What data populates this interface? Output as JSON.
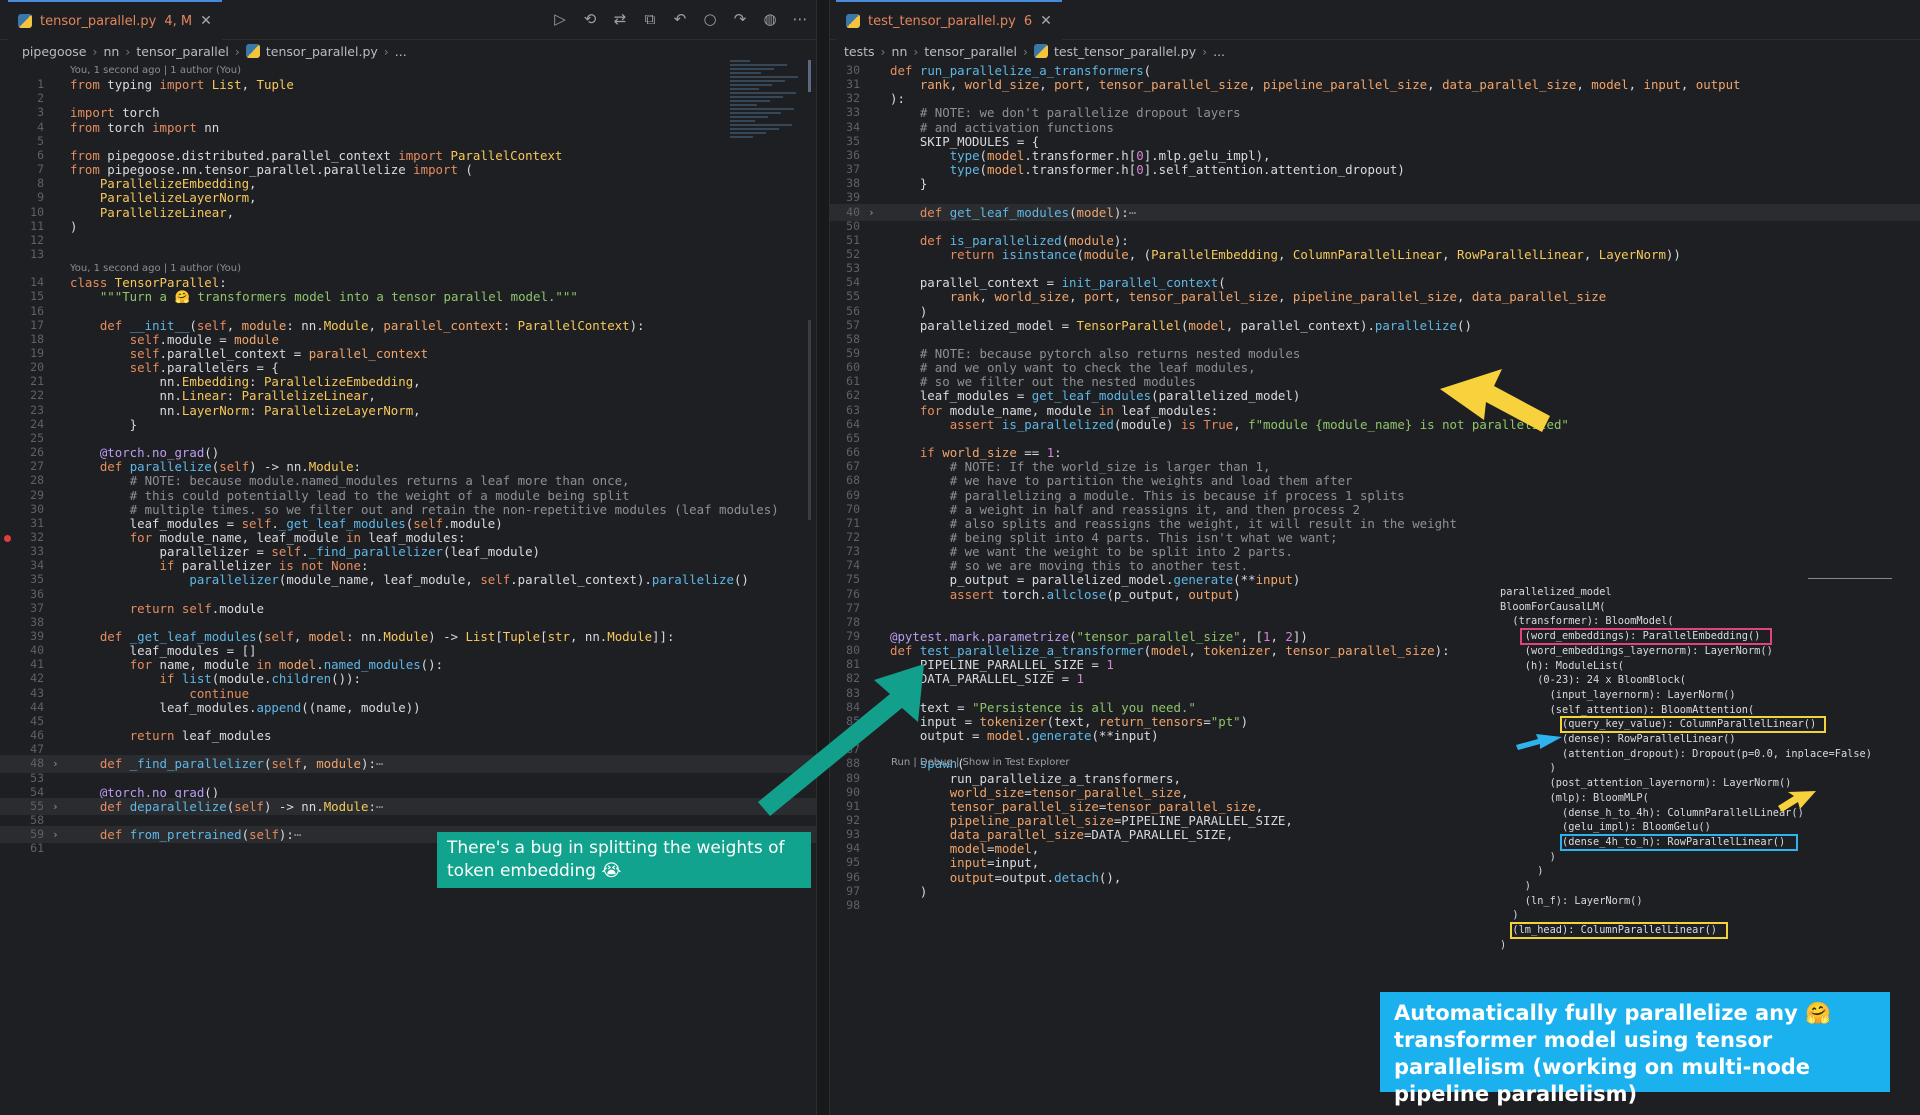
{
  "left": {
    "tab": {
      "name": "tensor_parallel.py",
      "status": "4, M"
    },
    "breadcrumbs": [
      "pipegoose",
      "nn",
      "tensor_parallel",
      "tensor_parallel.py",
      "..."
    ],
    "blame": [
      {
        "line": 1,
        "text": "You, 1 second ago | 1 author (You)"
      },
      {
        "line": 14,
        "text": "You, 1 second ago | 1 author (You)"
      }
    ],
    "lines": [
      {
        "n": "1",
        "h": "<span class='kw'>from</span> typing <span class='kw'>import</span> <span class='cl'>List</span>, <span class='cl'>Tuple</span>"
      },
      {
        "n": "2",
        "h": ""
      },
      {
        "n": "3",
        "h": "<span class='kw'>import</span> torch"
      },
      {
        "n": "4",
        "h": "<span class='kw'>from</span> torch <span class='kw'>import</span> nn"
      },
      {
        "n": "5",
        "h": ""
      },
      {
        "n": "6",
        "h": "<span class='kw'>from</span> pipegoose.distributed.parallel_context <span class='kw'>import</span> <span class='cl'>ParallelContext</span>"
      },
      {
        "n": "7",
        "h": "<span class='kw'>from</span> pipegoose.nn.tensor_parallel.parallelize <span class='kw'>import</span> ("
      },
      {
        "n": "8",
        "h": "    <span class='cl'>ParallelizeEmbedding</span>,"
      },
      {
        "n": "9",
        "h": "    <span class='cl'>ParallelizeLayerNorm</span>,"
      },
      {
        "n": "10",
        "h": "    <span class='cl'>ParallelizeLinear</span>,"
      },
      {
        "n": "11",
        "h": ")"
      },
      {
        "n": "12",
        "h": ""
      },
      {
        "n": "13",
        "h": ""
      },
      {
        "n": "14",
        "h": "<span class='kw'>class</span> <span class='cl'>TensorParallel</span>:"
      },
      {
        "n": "15",
        "h": "    <span class='st'>\"\"\"Turn a 🤗 transformers model into a tensor parallel model.\"\"\"</span>"
      },
      {
        "n": "16",
        "h": ""
      },
      {
        "n": "17",
        "h": "    <span class='kw'>def</span> <span class='fn'>__init__</span>(<span class='self'>self</span>, <span class='pa'>module</span>: nn.<span class='cl'>Module</span>, <span class='pa'>parallel_context</span>: <span class='cl'>ParallelContext</span>):"
      },
      {
        "n": "18",
        "h": "        <span class='self'>self</span>.module = <span class='pa'>module</span>"
      },
      {
        "n": "19",
        "h": "        <span class='self'>self</span>.parallel_context = <span class='pa'>parallel_context</span>"
      },
      {
        "n": "20",
        "h": "        <span class='self'>self</span>.parallelers = {"
      },
      {
        "n": "21",
        "h": "            nn.<span class='cl'>Embedding</span>: <span class='cl'>ParallelizeEmbedding</span>,"
      },
      {
        "n": "22",
        "h": "            nn.<span class='cl'>Linear</span>: <span class='cl'>ParallelizeLinear</span>,"
      },
      {
        "n": "23",
        "h": "            nn.<span class='cl'>LayerNorm</span>: <span class='cl'>ParallelizeLayerNorm</span>,"
      },
      {
        "n": "24",
        "h": "        }"
      },
      {
        "n": "25",
        "h": ""
      },
      {
        "n": "26",
        "h": "    <span class='dc'>@torch.no_grad</span>()"
      },
      {
        "n": "27",
        "h": "    <span class='kw'>def</span> <span class='fn'>parallelize</span>(<span class='self'>self</span>) -> nn.<span class='cl'>Module</span>:"
      },
      {
        "n": "28",
        "h": "        <span class='cm'># NOTE: because module.named_modules returns a leaf more than once,</span>"
      },
      {
        "n": "29",
        "h": "        <span class='cm'># this could potentially lead to the weight of a module being split</span>"
      },
      {
        "n": "30",
        "h": "        <span class='cm'># multiple times. so we filter out and retain the non-repetitive modules (leaf modules)</span>"
      },
      {
        "n": "31",
        "h": "        leaf_modules = <span class='self'>self</span>.<span class='fn'>_get_leaf_modules</span>(<span class='self'>self</span>.module)"
      },
      {
        "n": "32",
        "h": "        <span class='kw'>for</span> module_name, leaf_module <span class='kw'>in</span> leaf_modules:",
        "dot": true
      },
      {
        "n": "33",
        "h": "            parallelizer = <span class='self'>self</span>.<span class='fn'>_find_parallelizer</span>(leaf_module)"
      },
      {
        "n": "34",
        "h": "            <span class='kw'>if</span> parallelizer <span class='kw'>is not</span> <span class='kw'>None</span>:"
      },
      {
        "n": "35",
        "h": "                <span class='fn'>parallelizer</span>(module_name, leaf_module, <span class='self'>self</span>.parallel_context).<span class='fn'>parallelize</span>()"
      },
      {
        "n": "36",
        "h": ""
      },
      {
        "n": "37",
        "h": "        <span class='kw'>return</span> <span class='self'>self</span>.module"
      },
      {
        "n": "38",
        "h": ""
      },
      {
        "n": "39",
        "h": "    <span class='kw'>def</span> <span class='fn'>_get_leaf_modules</span>(<span class='self'>self</span>, <span class='pa'>model</span>: nn.<span class='cl'>Module</span>) -> <span class='cl'>List</span>[<span class='cl'>Tuple</span>[<span class='cl'>str</span>, nn.<span class='cl'>Module</span>]]:"
      },
      {
        "n": "40",
        "h": "        leaf_modules = []"
      },
      {
        "n": "41",
        "h": "        <span class='kw'>for</span> name, module <span class='kw'>in</span> <span class='pa'>model</span>.<span class='fn'>named_modules</span>():"
      },
      {
        "n": "42",
        "h": "            <span class='kw'>if</span> <span class='fn'>list</span>(module.<span class='fn'>children</span>()):"
      },
      {
        "n": "43",
        "h": "                <span class='kw'>continue</span>"
      },
      {
        "n": "44",
        "h": "            leaf_modules.<span class='fn'>append</span>((name, module))"
      },
      {
        "n": "45",
        "h": ""
      },
      {
        "n": "46",
        "h": "        <span class='kw'>return</span> leaf_modules"
      },
      {
        "n": "47",
        "h": ""
      },
      {
        "n": "48",
        "h": "    <span class='kw'>def</span> <span class='fn'>_find_parallelizer</span>(<span class='self'>self</span>, <span class='pa'>module</span>):<span class='cm'>⋯</span>",
        "fold": true,
        "hl": true
      },
      {
        "n": "53",
        "h": ""
      },
      {
        "n": "54",
        "h": "    <span class='dc'>@torch.no_grad</span>()"
      },
      {
        "n": "55",
        "h": "    <span class='kw'>def</span> <span class='fn'>deparallelize</span>(<span class='self'>self</span>) -> nn.<span class='cl'>Module</span>:<span class='cm'>⋯</span>",
        "fold": true,
        "hl": true
      },
      {
        "n": "58",
        "h": ""
      },
      {
        "n": "59",
        "h": "    <span class='kw'>def</span> <span class='fn'>from_pretrained</span>(<span class='self'>self</span>):<span class='cm'>⋯</span>",
        "fold": true,
        "hl": true
      },
      {
        "n": "61",
        "h": ""
      }
    ]
  },
  "right": {
    "tab": {
      "name": "test_tensor_parallel.py",
      "status": "6"
    },
    "breadcrumbs": [
      "tests",
      "nn",
      "tensor_parallel",
      "test_tensor_parallel.py",
      "..."
    ],
    "codelens": "Run | Debug | Show in Test Explorer",
    "lines": [
      {
        "n": "30",
        "h": "<span class='kw'>def</span> <span class='fn'>run_parallelize_a_transformers</span>("
      },
      {
        "n": "31",
        "h": "    <span class='pa'>rank</span>, <span class='pa'>world_size</span>, <span class='pa'>port</span>, <span class='pa'>tensor_parallel_size</span>, <span class='pa'>pipeline_parallel_size</span>, <span class='pa'>data_parallel_size</span>, <span class='pa'>model</span>, <span class='pa'>input</span>, <span class='pa'>output</span>"
      },
      {
        "n": "32",
        "h": "):"
      },
      {
        "n": "33",
        "h": "    <span class='cm'># NOTE: we don't parallelize dropout layers</span>"
      },
      {
        "n": "34",
        "h": "    <span class='cm'># and activation functions</span>"
      },
      {
        "n": "35",
        "h": "    SKIP_MODULES = {"
      },
      {
        "n": "36",
        "h": "        <span class='fn'>type</span>(<span class='pa'>model</span>.transformer.h[<span class='nm'>0</span>].mlp.gelu_impl),"
      },
      {
        "n": "37",
        "h": "        <span class='fn'>type</span>(<span class='pa'>model</span>.transformer.h[<span class='nm'>0</span>].self_attention.attention_dropout)"
      },
      {
        "n": "38",
        "h": "    }"
      },
      {
        "n": "39",
        "h": ""
      },
      {
        "n": "40",
        "h": "    <span class='kw'>def</span> <span class='fn'>get_leaf_modules</span>(<span class='pa'>model</span>):<span class='cm'>⋯</span>",
        "fold": true,
        "hl": true
      },
      {
        "n": "50",
        "h": ""
      },
      {
        "n": "51",
        "h": "    <span class='kw'>def</span> <span class='fn'>is_parallelized</span>(<span class='pa'>module</span>):"
      },
      {
        "n": "52",
        "h": "        <span class='kw'>return</span> <span class='fn'>isinstance</span>(<span class='pa'>module</span>, (<span class='cl'>ParallelEmbedding</span>, <span class='cl'>ColumnParallelLinear</span>, <span class='cl'>RowParallelLinear</span>, <span class='cl'>LayerNorm</span>))"
      },
      {
        "n": "53",
        "h": ""
      },
      {
        "n": "54",
        "h": "    parallel_context = <span class='fn'>init_parallel_context</span>("
      },
      {
        "n": "55",
        "h": "        <span class='pa'>rank</span>, <span class='pa'>world_size</span>, <span class='pa'>port</span>, <span class='pa'>tensor_parallel_size</span>, <span class='pa'>pipeline_parallel_size</span>, <span class='pa'>data_parallel_size</span>"
      },
      {
        "n": "56",
        "h": "    )"
      },
      {
        "n": "57",
        "h": "    parallelized_model = <span class='cl'>TensorParallel</span>(<span class='pa'>model</span>, parallel_context).<span class='fn'>parallelize</span>()"
      },
      {
        "n": "58",
        "h": ""
      },
      {
        "n": "59",
        "h": "    <span class='cm'># NOTE: because pytorch also returns nested modules</span>"
      },
      {
        "n": "60",
        "h": "    <span class='cm'># and we only want to check the leaf modules,</span>"
      },
      {
        "n": "61",
        "h": "    <span class='cm'># so we filter out the nested modules</span>"
      },
      {
        "n": "62",
        "h": "    leaf_modules = <span class='fn'>get_leaf_modules</span>(parallelized_model)"
      },
      {
        "n": "63",
        "h": "    <span class='kw'>for</span> module_name, module <span class='kw'>in</span> leaf_modules:"
      },
      {
        "n": "64",
        "h": "        <span class='kw'>assert</span> <span class='fn'>is_parallelized</span>(module) <span class='kw'>is</span> <span class='kw'>True</span>, <span class='st'>f\"module {module_name} is not parallelized\"</span>"
      },
      {
        "n": "65",
        "h": ""
      },
      {
        "n": "66",
        "h": "    <span class='kw'>if</span> <span class='pa'>world_size</span> == <span class='nm'>1</span>:"
      },
      {
        "n": "67",
        "h": "        <span class='cm'># NOTE: If the world_size is larger than 1,</span>"
      },
      {
        "n": "68",
        "h": "        <span class='cm'># we have to partition the weights and load them after</span>"
      },
      {
        "n": "69",
        "h": "        <span class='cm'># parallelizing a module. This is because if process 1 splits</span>"
      },
      {
        "n": "70",
        "h": "        <span class='cm'># a weight in half and reassigns it, and then process 2</span>"
      },
      {
        "n": "71",
        "h": "        <span class='cm'># also splits and reassigns the weight, it will result in the weight</span>"
      },
      {
        "n": "72",
        "h": "        <span class='cm'># being split into 4 parts. This isn't what we want;</span>"
      },
      {
        "n": "73",
        "h": "        <span class='cm'># we want the weight to be split into 2 parts.</span>"
      },
      {
        "n": "74",
        "h": "        <span class='cm'># so we are moving this to another test.</span>"
      },
      {
        "n": "75",
        "h": "        p_output = parallelized_model.<span class='fn'>generate</span>(**<span class='pa'>input</span>)",
        "dot": true
      },
      {
        "n": "76",
        "h": "        <span class='kw'>assert</span> torch.<span class='fn'>allclose</span>(p_output, <span class='pa'>output</span>)"
      },
      {
        "n": "77",
        "h": ""
      },
      {
        "n": "78",
        "h": ""
      },
      {
        "n": "79",
        "h": "<span class='dc'>@pytest.mark.parametrize</span>(<span class='st'>\"tensor_parallel_size\"</span>, [<span class='nm'>1</span>, <span class='nm'>2</span>])"
      },
      {
        "n": "80",
        "h": "<span class='kw'>def</span> <span class='fn'>test_parallelize_a_transformer</span>(<span class='pa'>model</span>, <span class='pa'>tokenizer</span>, <span class='pa'>tensor_parallel_size</span>):"
      },
      {
        "n": "81",
        "h": "    PIPELINE_PARALLEL_SIZE = <span class='nm'>1</span>"
      },
      {
        "n": "82",
        "h": "    DATA_PARALLEL_SIZE = <span class='nm'>1</span>"
      },
      {
        "n": "83",
        "h": ""
      },
      {
        "n": "84",
        "h": "    text = <span class='st'>\"Persistence is all you need.\"</span>"
      },
      {
        "n": "85",
        "h": "    input = <span class='pa'>tokenizer</span>(text, <span class='pa'>return_tensors</span>=<span class='st'>\"pt\"</span>)"
      },
      {
        "n": "86",
        "h": "    output = <span class='pa'>model</span>.<span class='fn'>generate</span>(**input)"
      },
      {
        "n": "87",
        "h": ""
      },
      {
        "n": "88",
        "h": "    <span class='fn'>spawn</span>("
      },
      {
        "n": "89",
        "h": "        run_parallelize_a_transformers,"
      },
      {
        "n": "90",
        "h": "        <span class='pa'>world_size</span>=<span class='pa'>tensor_parallel_size</span>,"
      },
      {
        "n": "91",
        "h": "        <span class='pa'>tensor_parallel_size</span>=<span class='pa'>tensor_parallel_size</span>,"
      },
      {
        "n": "92",
        "h": "        <span class='pa'>pipeline_parallel_size</span>=PIPELINE_PARALLEL_SIZE,"
      },
      {
        "n": "93",
        "h": "        <span class='pa'>data_parallel_size</span>=DATA_PARALLEL_SIZE,"
      },
      {
        "n": "94",
        "h": "        <span class='pa'>model</span>=<span class='pa'>model</span>,"
      },
      {
        "n": "95",
        "h": "        <span class='pa'>input</span>=input,"
      },
      {
        "n": "96",
        "h": "        <span class='pa'>output</span>=output.<span class='fn'>detach</span>(),"
      },
      {
        "n": "97",
        "h": "    )"
      },
      {
        "n": "98",
        "h": ""
      }
    ]
  },
  "printout": [
    "parallelized_model",
    "BloomForCausalLM(",
    "  (transformer): BloomModel(",
    "    (word_embeddings): ParallelEmbedding()",
    "    (word_embeddings_layernorm): LayerNorm()",
    "    (h): ModuleList(",
    "      (0-23): 24 x BloomBlock(",
    "        (input_layernorm): LayerNorm()",
    "        (self_attention): BloomAttention(",
    "          (query_key_value): ColumnParallelLinear()",
    "          (dense): RowParallelLinear()",
    "          (attention_dropout): Dropout(p=0.0, inplace=False)",
    "        )",
    "        (post_attention_layernorm): LayerNorm()",
    "        (mlp): BloomMLP(",
    "          (dense_h_to_4h): ColumnParallelLinear()",
    "          (gelu_impl): BloomGelu()",
    "          (dense_4h_to_h): RowParallelLinear()",
    "        )",
    "      )",
    "    )",
    "    (ln_f): LayerNorm()",
    "  )",
    "  (lm_head): ColumnParallelLinear()",
    ")"
  ],
  "callouts": {
    "bug": "There's a bug in splitting the weights of token embedding 😭",
    "auto": "Automatically fully parallelize any 🤗 transformer model using tensor parallelism (working on multi-node pipeline parallelism)"
  },
  "toolbar": {
    "run": "▷",
    "history": "⟲",
    "branch": "⇄",
    "compare": "⧉",
    "back": "↶",
    "circle": "○",
    "fwd": "↷",
    "github": "◍",
    "more": "⋯"
  }
}
